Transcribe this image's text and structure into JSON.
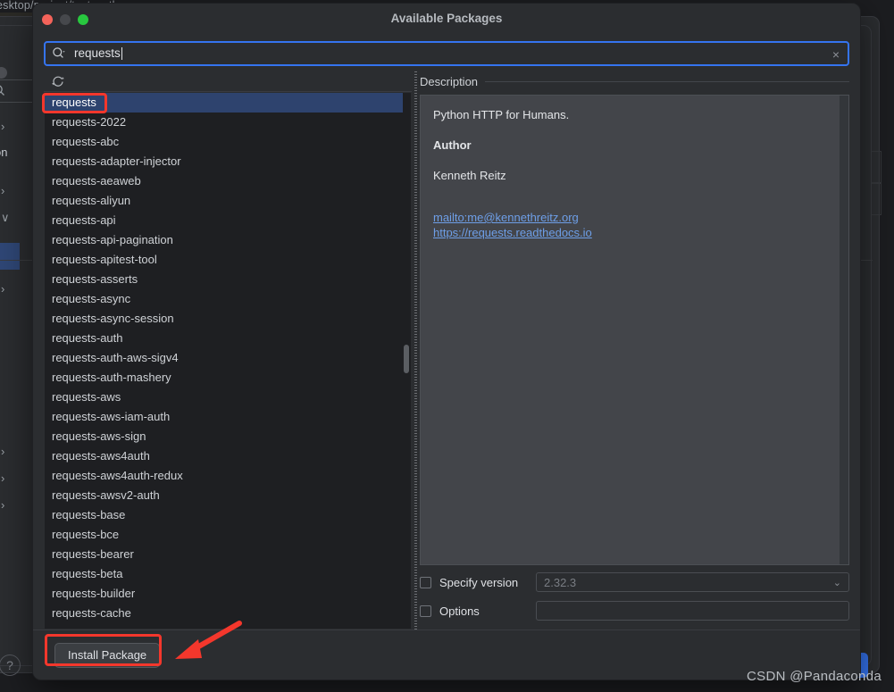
{
  "background": {
    "editor_path": "esktop/project/test_python",
    "side_text": "on",
    "help_icon": "?"
  },
  "dialog": {
    "title": "Available Packages",
    "window_controls": {
      "close": "close-button",
      "minimize": "minimize-button",
      "zoom": "zoom-button"
    }
  },
  "search": {
    "value": "requests",
    "placeholder": "",
    "icon": "search-icon",
    "clear_icon": "×"
  },
  "toolbar": {
    "refresh_icon": "refresh-icon"
  },
  "packages": {
    "selected": "requests",
    "items": [
      "requests",
      "requests-2022",
      "requests-abc",
      "requests-adapter-injector",
      "requests-aeaweb",
      "requests-aliyun",
      "requests-api",
      "requests-api-pagination",
      "requests-apitest-tool",
      "requests-asserts",
      "requests-async",
      "requests-async-session",
      "requests-auth",
      "requests-auth-aws-sigv4",
      "requests-auth-mashery",
      "requests-aws",
      "requests-aws-iam-auth",
      "requests-aws-sign",
      "requests-aws4auth",
      "requests-aws4auth-redux",
      "requests-awsv2-auth",
      "requests-base",
      "requests-bce",
      "requests-bearer",
      "requests-beta",
      "requests-builder",
      "requests-cache"
    ]
  },
  "description": {
    "header": "Description",
    "summary": "Python HTTP for Humans.",
    "author_label": "Author",
    "author_name": "Kenneth Reitz",
    "links": [
      "mailto:me@kennethreitz.org",
      "https://requests.readthedocs.io"
    ]
  },
  "options": {
    "specify_version": {
      "label": "Specify version",
      "checked": false,
      "value": "2.32.3",
      "chevron": "⌄"
    },
    "options": {
      "label": "Options",
      "checked": false,
      "value": ""
    }
  },
  "footer": {
    "install_label": "Install Package"
  },
  "watermark": "CSDN @Pandaconda",
  "colors": {
    "accent": "#3574f0",
    "selection": "#2e436e",
    "annotation": "#f4372c",
    "link": "#6e9fe8",
    "dialog_bg": "#2b2d30",
    "list_bg": "#1e1f22",
    "desc_bg": "#43454a"
  }
}
